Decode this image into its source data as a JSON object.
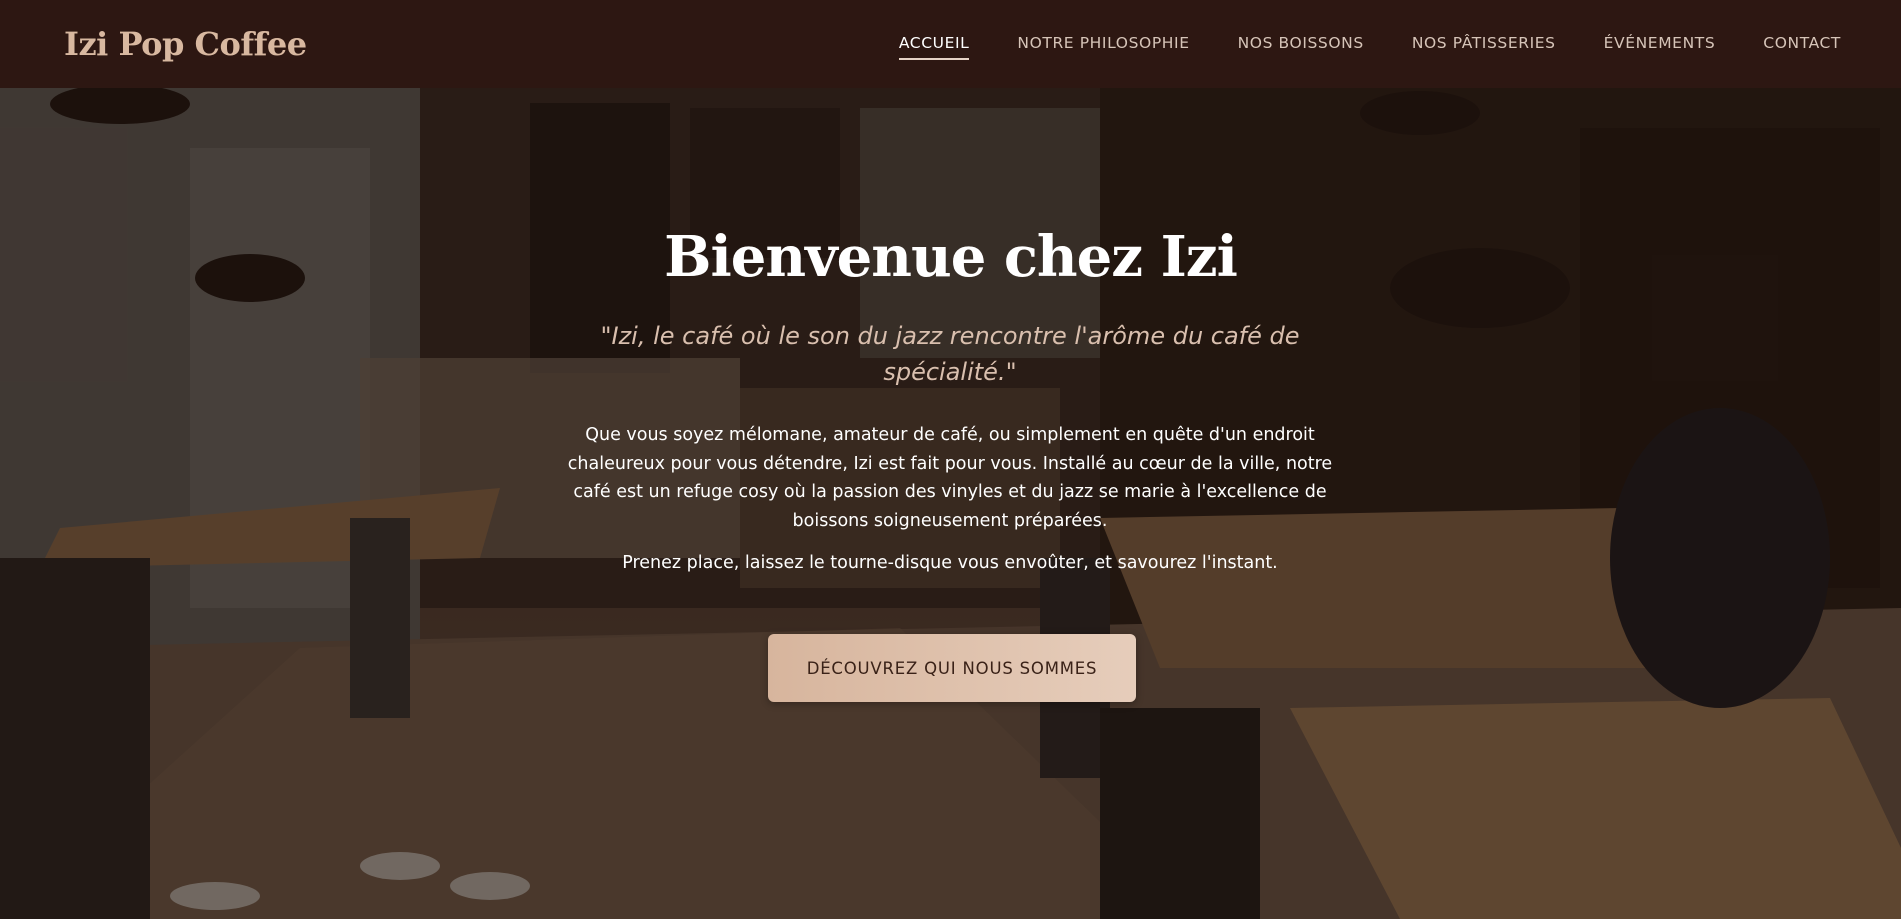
{
  "header": {
    "logo": "Izi Pop Coffee",
    "nav": [
      {
        "label": "ACCUEIL",
        "active": true
      },
      {
        "label": "NOTRE PHILOSOPHIE",
        "active": false
      },
      {
        "label": "NOS BOISSONS",
        "active": false
      },
      {
        "label": "NOS PÂTISSERIES",
        "active": false
      },
      {
        "label": "ÉVÉNEMENTS",
        "active": false
      },
      {
        "label": "CONTACT",
        "active": false
      }
    ]
  },
  "hero": {
    "title": "Bienvenue chez Izi",
    "quote": "\"Izi, le café où le son du jazz rencontre l'arôme du café de spécialité.\"",
    "body": "Que vous soyez mélomane, amateur de café, ou simplement en quête d'un endroit chaleureux pour vous détendre, Izi est fait pour vous. Installé au cœur de la ville, notre café est un refuge cosy où la passion des vinyles et du jazz se marie à l'excellence de boissons soigneusement préparées.",
    "body2": "Prenez place, laissez le tourne-disque vous envoûter, et savourez l'instant.",
    "cta": "DÉCOUVREZ QUI NOUS SOMMES",
    "background_image": "café interior photo"
  },
  "colors": {
    "header_bg": "#2d1712",
    "logo": "#d8b8a0",
    "quote": "#d9bfae",
    "cta_bg": "#dcbfa9",
    "cta_text": "#3a2218"
  }
}
